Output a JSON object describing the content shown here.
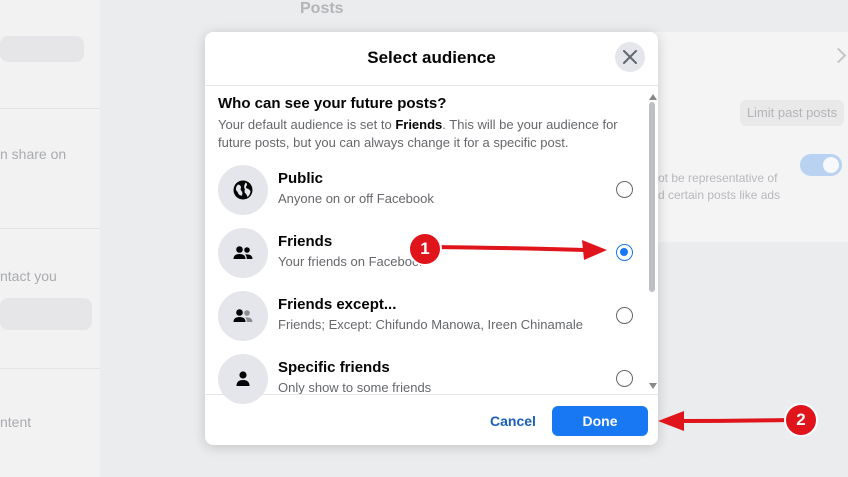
{
  "background": {
    "posts_heading": "Posts",
    "share_on": "n share on",
    "contact_you": "ntact you",
    "content": "ntent",
    "limit_past_posts": "Limit past posts",
    "representative_line1": "ot be representative of",
    "representative_line2": "d certain posts like ads"
  },
  "dialog": {
    "title": "Select audience",
    "close_icon": "close-icon",
    "heading": "Who can see your future posts?",
    "description_pre": "Your default audience is set to ",
    "description_bold": "Friends",
    "description_post": ". This will be your audience for future posts, but you can always change it for a specific post.",
    "options": [
      {
        "label": "Public",
        "description": "Anyone on or off Facebook",
        "icon": "globe-icon",
        "selected": false
      },
      {
        "label": "Friends",
        "description": "Your friends on Facebook",
        "icon": "friends-icon",
        "selected": true
      },
      {
        "label": "Friends except...",
        "description": "Friends; Except: Chifundo Manowa, Ireen Chinamale",
        "icon": "friends-except-icon",
        "selected": false
      },
      {
        "label": "Specific friends",
        "description": "Only show to some friends",
        "icon": "person-icon",
        "selected": false
      }
    ],
    "cancel_label": "Cancel",
    "done_label": "Done"
  },
  "annotations": [
    {
      "number": "1",
      "target": "friends radio"
    },
    {
      "number": "2",
      "target": "Done button"
    }
  ],
  "colors": {
    "accent": "#1877f2",
    "annotation_red": "#e0141b"
  }
}
